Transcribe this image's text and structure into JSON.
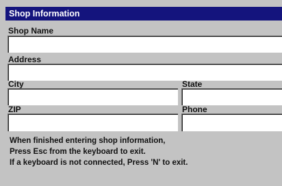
{
  "window": {
    "title": "Shop Information"
  },
  "form": {
    "shop_name": {
      "label": "Shop Name",
      "value": ""
    },
    "address": {
      "label": "Address",
      "value": ""
    },
    "city": {
      "label": "City",
      "value": ""
    },
    "state": {
      "label": "State",
      "value": ""
    },
    "zip": {
      "label": "ZIP",
      "value": ""
    },
    "phone": {
      "label": "Phone",
      "value": ""
    }
  },
  "instructions": [
    "When finished entering shop information,",
    "Press Esc from the keyboard to exit.",
    "If a keyboard is not connected, Press 'N' to exit."
  ]
}
